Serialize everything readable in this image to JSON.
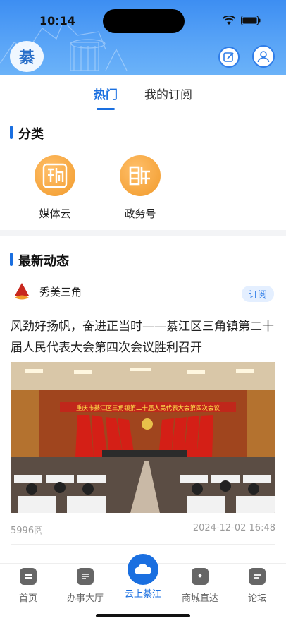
{
  "status_bar": {
    "time": "10:14"
  },
  "header": {
    "logo_text": "綦",
    "edit_icon": "edit-icon",
    "user_icon": "user-icon"
  },
  "tabs": [
    {
      "label": "热门",
      "active": true
    },
    {
      "label": "我的订阅",
      "active": false
    }
  ],
  "categories": {
    "title": "分类",
    "items": [
      {
        "label": "媒体云",
        "glyph": "融"
      },
      {
        "label": "政务号",
        "glyph": "新"
      }
    ]
  },
  "latest": {
    "title": "最新动态",
    "post": {
      "source": "秀美三角",
      "subscribe_label": "订阅",
      "headline": "风劲好扬帆，奋进正当时——綦江区三角镇第二十届人民代表大会第四次会议胜利召开",
      "photo_banner": "重庆市綦江区三角镇第二十届人民代表大会第四次会议",
      "views": "5996阅",
      "date": "2024-12-02 16:48"
    }
  },
  "bottom_nav": [
    {
      "label": "首页"
    },
    {
      "label": "办事大厅"
    },
    {
      "label": "云上綦江"
    },
    {
      "label": "商城直达"
    },
    {
      "label": "论坛"
    }
  ],
  "colors": {
    "accent": "#1a6fe0",
    "header_blue": "#3d8ef2",
    "category_orange": "#f19a2a"
  }
}
